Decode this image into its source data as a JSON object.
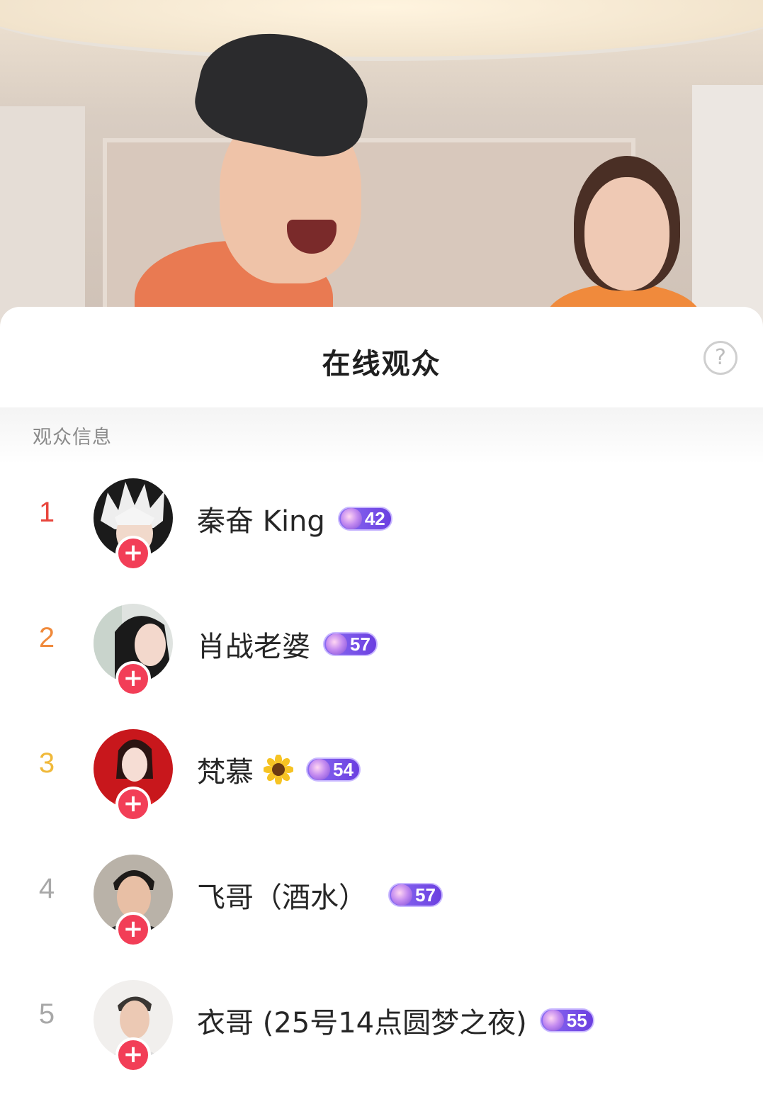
{
  "sheet": {
    "title": "在线观众",
    "help_icon": "?",
    "section_label": "观众信息"
  },
  "viewers": [
    {
      "rank": "1",
      "rank_color": "#e8453c",
      "name": "秦奋 King",
      "level": "42",
      "avatar": "spiky-white-hair-anime-avatar"
    },
    {
      "rank": "2",
      "rank_color": "#f08a3c",
      "name": "肖战老婆",
      "level": "57",
      "avatar": "woman-portrait-avatar"
    },
    {
      "rank": "3",
      "rank_color": "#f0b93a",
      "name": "梵慕",
      "emoji": "sunflower",
      "level": "54",
      "avatar": "woman-red-dress-avatar"
    },
    {
      "rank": "4",
      "rank_color": "#a8a8a8",
      "name": "飞哥（酒水）",
      "level": "57",
      "avatar": "man-selfie-avatar"
    },
    {
      "rank": "5",
      "rank_color": "#a8a8a8",
      "name": "衣哥 (25号14点圆梦之夜)",
      "level": "55",
      "avatar": "man-light-background-avatar"
    }
  ],
  "follow_label": "+",
  "colors": {
    "follow": "#f23e57",
    "badge": "#6b3fe0"
  }
}
